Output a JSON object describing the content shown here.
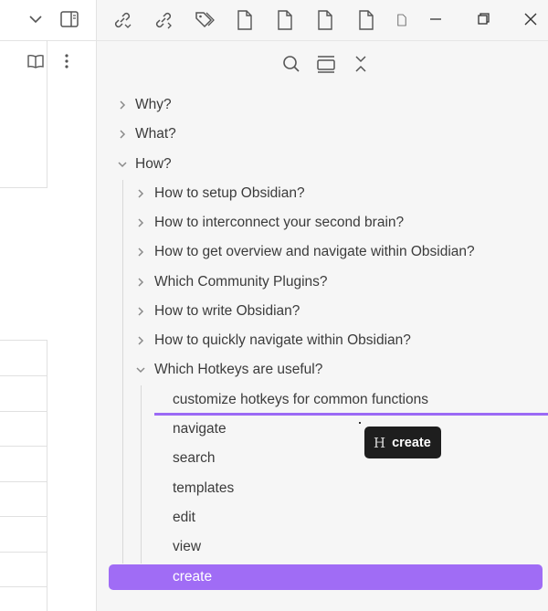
{
  "outline": {
    "top_items": [
      {
        "label": "Why?",
        "expanded": false
      },
      {
        "label": "What?",
        "expanded": false
      },
      {
        "label": "How?",
        "expanded": true
      }
    ],
    "how_children": [
      {
        "label": "How to setup Obsidian?",
        "expanded": false
      },
      {
        "label": "How to interconnect your second brain?",
        "expanded": false
      },
      {
        "label": "How to get overview and navigate within Obsidian?",
        "expanded": false
      },
      {
        "label": "Which Community Plugins?",
        "expanded": false
      },
      {
        "label": "How to write Obsidian?",
        "expanded": false
      },
      {
        "label": "How to quickly navigate within Obsidian?",
        "expanded": false
      },
      {
        "label": "Which Hotkeys are useful?",
        "expanded": true
      }
    ],
    "hotkey_children": [
      "customize hotkeys for common functions",
      "navigate",
      "search",
      "templates",
      "edit",
      "view",
      "create"
    ],
    "selected": "create"
  },
  "tooltip": {
    "heading_symbol": "H",
    "label": "create"
  },
  "colors": {
    "accent": "#a06cf5",
    "tooltip_bg": "#1e1e1e",
    "pane_bg": "#f6f6f6"
  },
  "icons": {
    "titlebar": [
      "chevron-down-icon",
      "sidebar-toggle-icon",
      "backlinks-icon",
      "outgoing-links-icon",
      "tags-icon",
      "file-icon",
      "file-icon",
      "file-icon",
      "file-icon",
      "file-icon",
      "minimize-icon",
      "restore-icon",
      "close-icon"
    ],
    "left_toolbar": [
      "book-open-icon",
      "more-vertical-icon"
    ],
    "outline_toolbar": [
      "search-icon",
      "collapse-all-icon",
      "expand-collapse-icon"
    ]
  }
}
